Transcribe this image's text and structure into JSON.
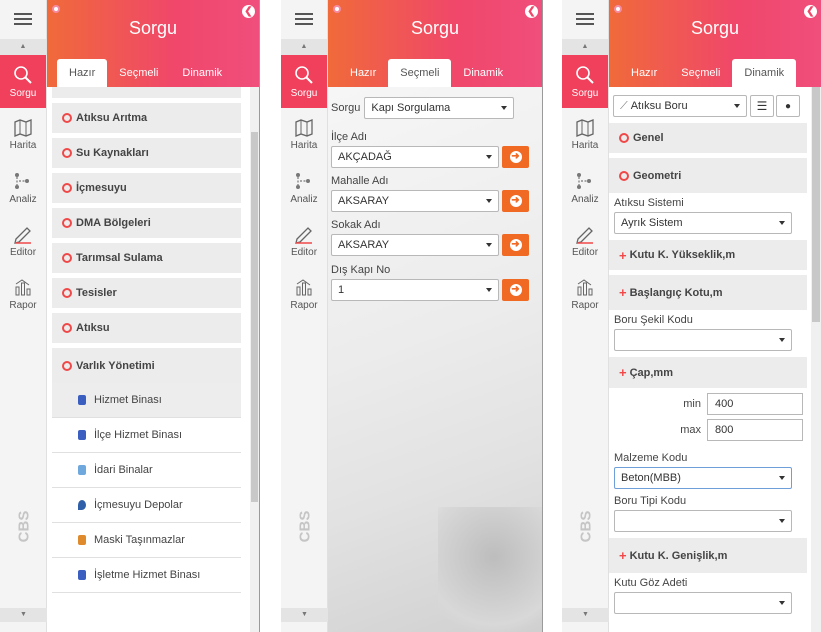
{
  "header_title": "Sorgu",
  "tabs": [
    "Hazır",
    "Seçmeli",
    "Dinamik"
  ],
  "rail": {
    "items": [
      {
        "label": "Sorgu",
        "icon": "search-icon"
      },
      {
        "label": "Harita",
        "icon": "map-icon"
      },
      {
        "label": "Analiz",
        "icon": "analysis-icon"
      },
      {
        "label": "Editor",
        "icon": "pencil-icon"
      },
      {
        "label": "Rapor",
        "icon": "report-icon"
      }
    ],
    "brand": "CBS"
  },
  "accent_color": "#f0476a",
  "panel1": {
    "categories": [
      "Atıksu Arıtma",
      "Su Kaynakları",
      "İçmesuyu",
      "DMA Bölgeleri",
      "Tarımsal Sulama",
      "Tesisler",
      "Atıksu",
      "Varlık Yönetimi"
    ],
    "subitems": [
      "Hizmet Binası",
      "İlçe Hizmet Binası",
      "İdari Binalar",
      "İçmesuyu Depolar",
      "Maski Taşınmazlar",
      "İşletme Hizmet Binası"
    ]
  },
  "panel2": {
    "sorgu_label": "Sorgu",
    "sorgu_value": "Kapı Sorgulama",
    "fields": [
      {
        "label": "İlçe Adı",
        "value": "AKÇADAĞ"
      },
      {
        "label": "Mahalle Adı",
        "value": "AKSARAY"
      },
      {
        "label": "Sokak Adı",
        "value": "AKSARAY"
      },
      {
        "label": "Dış Kapı No",
        "value": "1"
      }
    ]
  },
  "panel3": {
    "layer": "Atıksu Boru",
    "genel": "Genel",
    "geometri": "Geometri",
    "atiksu_sistemi_label": "Atıksu Sistemi",
    "atiksu_sistemi_value": "Ayrık Sistem",
    "kutu_yukseklik": "Kutu K. Yükseklik,m",
    "baslangic_kotu": "Başlangıç Kotu,m",
    "boru_sekil_label": "Boru Şekil Kodu",
    "cap": "Çap,mm",
    "min_label": "min",
    "min_value": "400",
    "max_label": "max",
    "max_value": "800",
    "malzeme_label": "Malzeme Kodu",
    "malzeme_value": "Beton(MBB)",
    "boru_tipi_label": "Boru Tipi Kodu",
    "kutu_genislik": "Kutu K. Genişlik,m",
    "kutu_goz_label": "Kutu Göz Adeti"
  }
}
